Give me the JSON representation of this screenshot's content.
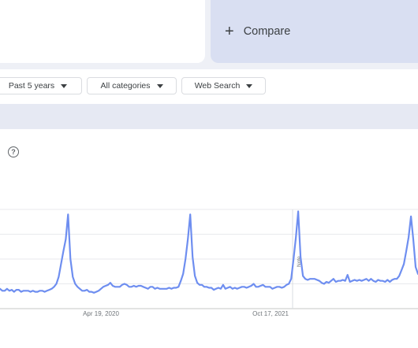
{
  "compare": {
    "label": "Compare"
  },
  "filters": [
    {
      "label": "Past 5 years"
    },
    {
      "label": "All categories"
    },
    {
      "label": "Web Search"
    }
  ],
  "help": {
    "glyph": "?"
  },
  "colors": {
    "line": "#6e8ef0",
    "grid": "#e8eaed",
    "compare_bg": "#d9dff2"
  },
  "chart_data": {
    "type": "line",
    "title": "",
    "xlabel": "",
    "ylabel": "",
    "x_tick_labels": [
      "Apr 19, 2020",
      "Oct 17, 2021"
    ],
    "annotation": "Note",
    "series": [
      {
        "values": [
          20,
          18,
          18,
          20,
          18,
          19,
          17,
          19,
          19,
          17,
          18,
          18,
          18,
          17,
          18,
          17,
          17,
          18,
          18,
          17,
          18,
          19,
          20,
          22,
          25,
          32,
          45,
          58,
          70,
          95,
          50,
          32,
          25,
          22,
          20,
          18,
          18,
          19,
          17,
          17,
          16,
          17,
          18,
          20,
          22,
          23,
          24,
          26,
          23,
          22,
          22,
          22,
          24,
          25,
          24,
          22,
          22,
          23,
          22,
          23,
          23,
          22,
          21,
          20,
          22,
          22,
          20,
          21,
          20,
          20,
          20,
          20,
          21,
          20,
          21,
          21,
          22,
          28,
          35,
          50,
          70,
          95,
          52,
          33,
          26,
          24,
          24,
          22,
          22,
          21,
          21,
          19,
          20,
          21,
          20,
          24,
          20,
          21,
          22,
          20,
          21,
          20,
          21,
          22,
          22,
          21,
          22,
          23,
          25,
          22,
          22,
          23,
          24,
          22,
          22,
          22,
          20,
          21,
          22,
          22,
          21,
          22,
          24,
          25,
          30,
          50,
          72,
          98,
          52,
          33,
          30,
          29,
          30,
          30,
          30,
          29,
          28,
          26,
          25,
          27,
          26,
          28,
          30,
          27,
          28,
          28,
          29,
          28,
          34,
          27,
          28,
          29,
          28,
          29,
          28,
          29,
          30,
          28,
          30,
          28,
          27,
          29,
          28,
          28,
          27,
          29,
          27,
          29,
          30,
          30,
          33,
          39,
          45,
          58,
          72,
          93,
          70,
          42,
          35
        ]
      }
    ]
  }
}
